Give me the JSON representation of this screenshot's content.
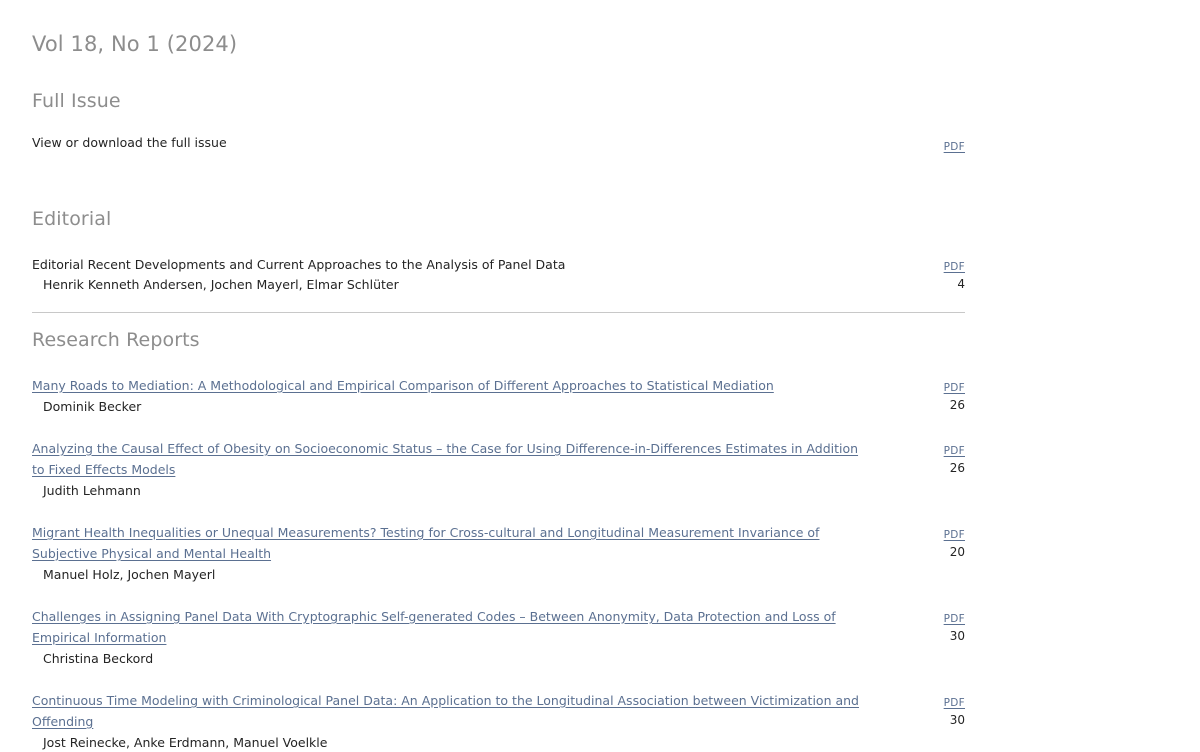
{
  "issue": {
    "title": "Vol 18, No 1 (2024)"
  },
  "sections": [
    {
      "id": "full-issue",
      "heading": "Full Issue",
      "entries": [
        {
          "kind": "plain",
          "text": "View or download the full issue",
          "pdf_label": "PDF",
          "pages": ""
        }
      ]
    },
    {
      "id": "editorial",
      "heading": "Editorial",
      "entries": [
        {
          "kind": "article",
          "title": "Editorial Recent Developments and Current Approaches to the Analysis of Panel Data",
          "title_is_link": false,
          "authors": "Henrik Kenneth Andersen, Jochen Mayerl, Elmar Schlüter",
          "pdf_label": "PDF",
          "pages": "4"
        }
      ]
    },
    {
      "id": "research-reports",
      "heading": "Research Reports",
      "entries": [
        {
          "kind": "article",
          "title": "Many Roads to Mediation: A Methodological and Empirical Comparison of Different Approaches to Statistical Mediation",
          "title_is_link": true,
          "authors": "Dominik Becker",
          "pdf_label": "PDF",
          "pages": "26"
        },
        {
          "kind": "article",
          "title": "Analyzing the Causal Effect of Obesity on Socioeconomic Status – the Case for Using Difference-in-Differences Estimates in Addition to Fixed Effects Models",
          "title_is_link": true,
          "authors": "Judith Lehmann",
          "pdf_label": "PDF",
          "pages": "26"
        },
        {
          "kind": "article",
          "title": "Migrant Health Inequalities or Unequal Measurements? Testing for Cross-cultural and Longitudinal Measurement Invariance of Subjective Physical and Mental Health",
          "title_is_link": true,
          "authors": "Manuel Holz, Jochen Mayerl",
          "pdf_label": "PDF",
          "pages": "20"
        },
        {
          "kind": "article",
          "title": "Challenges in Assigning Panel Data With Cryptographic Self-generated Codes – Between Anonymity, Data Protection and Loss of Empirical Information",
          "title_is_link": true,
          "authors": "Christina Beckord",
          "pdf_label": "PDF",
          "pages": "30"
        },
        {
          "kind": "article",
          "title": "Continuous Time Modeling with Criminological Panel Data: An Application to the Longitudinal Association between Victimization and Offending",
          "title_is_link": true,
          "authors": "Jost Reinecke, Anke Erdmann, Manuel Voelkle",
          "pdf_label": "PDF",
          "pages": "30"
        }
      ]
    }
  ],
  "colors": {
    "heading": "#8d8d8d",
    "link": "#5b7091",
    "text": "#242424",
    "divider": "#c8c8c8"
  }
}
